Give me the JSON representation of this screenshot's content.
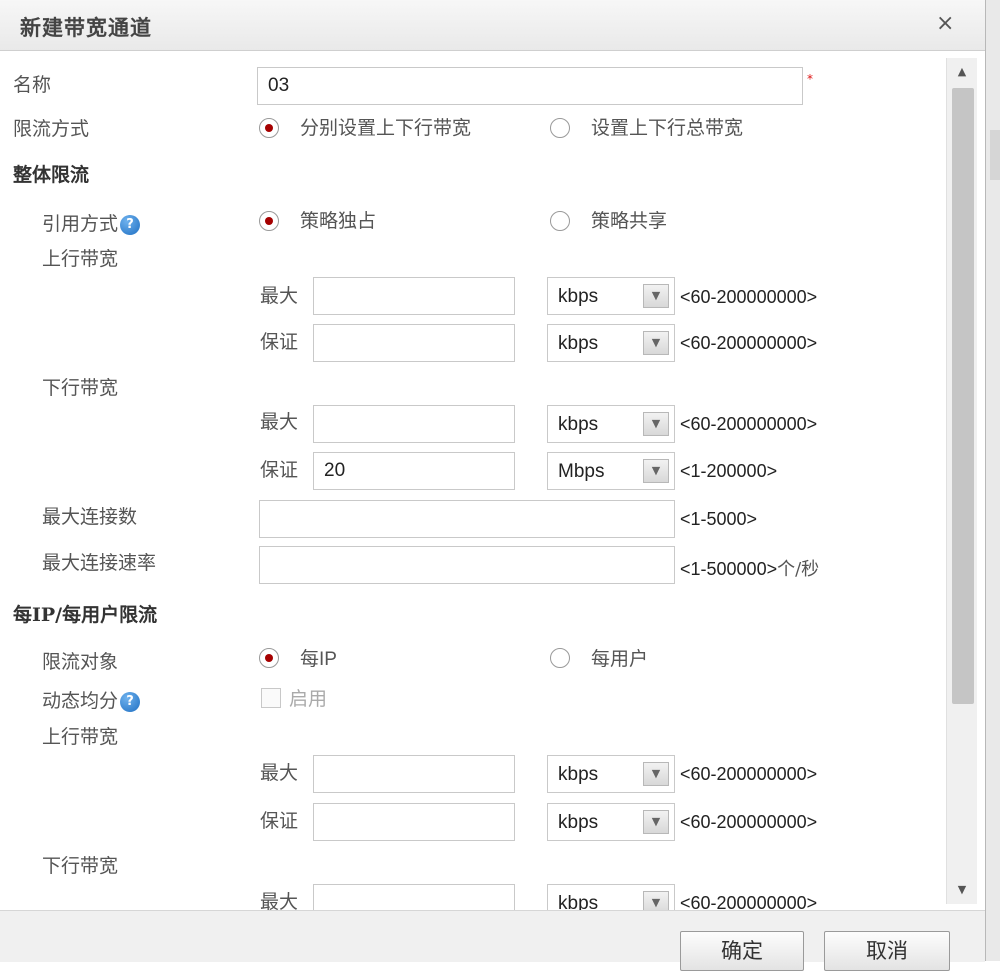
{
  "dialog": {
    "title": "新建带宽通道",
    "close": "×",
    "ok": "确定",
    "cancel": "取消"
  },
  "name": {
    "label": "名称",
    "value": "03",
    "required": "*"
  },
  "mode": {
    "label": "限流方式",
    "opt1": "分别设置上下行带宽",
    "opt2": "设置上下行总带宽",
    "selected": 1
  },
  "overall": {
    "title": "整体限流",
    "ref_label": "引用方式",
    "ref_opt1": "策略独占",
    "ref_opt2": "策略共享",
    "up_label": "上行带宽",
    "down_label": "下行带宽",
    "max_label": "最大",
    "guar_label": "保证",
    "up_max": {
      "value": "",
      "unit": "kbps",
      "range": "<60-200000000>"
    },
    "up_guar": {
      "value": "",
      "unit": "kbps",
      "range": "<60-200000000>"
    },
    "down_max": {
      "value": "",
      "unit": "kbps",
      "range": "<60-200000000>"
    },
    "down_guar": {
      "value": "20",
      "unit": "Mbps",
      "range": "<1-200000>"
    },
    "max_conn_label": "最大连接数",
    "max_conn_value": "",
    "max_conn_range": "<1-5000>",
    "max_rate_label": "最大连接速率",
    "max_rate_value": "",
    "max_rate_range": "<1-500000>",
    "max_rate_unit": "个/秒"
  },
  "per_ip": {
    "title": "每IP/每用户限流",
    "target_label": "限流对象",
    "target_opt1": "每IP",
    "target_opt2": "每用户",
    "dyn_label": "动态均分",
    "enable_label": "启用",
    "up_label": "上行带宽",
    "down_label": "下行带宽",
    "max_label": "最大",
    "guar_label": "保证",
    "up_max": {
      "value": "",
      "unit": "kbps",
      "range": "<60-200000000>"
    },
    "up_guar": {
      "value": "",
      "unit": "kbps",
      "range": "<60-200000000>"
    },
    "down_max": {
      "value": "",
      "unit": "kbps",
      "range": "<60-200000000>"
    }
  },
  "help_glyph": "?",
  "icons": {
    "select_arrow": "chevron-down-icon",
    "help": "help-icon"
  },
  "colors": {
    "radio_dot": "#a50000",
    "help": "#1f6fc2",
    "required": "#dd1111"
  }
}
